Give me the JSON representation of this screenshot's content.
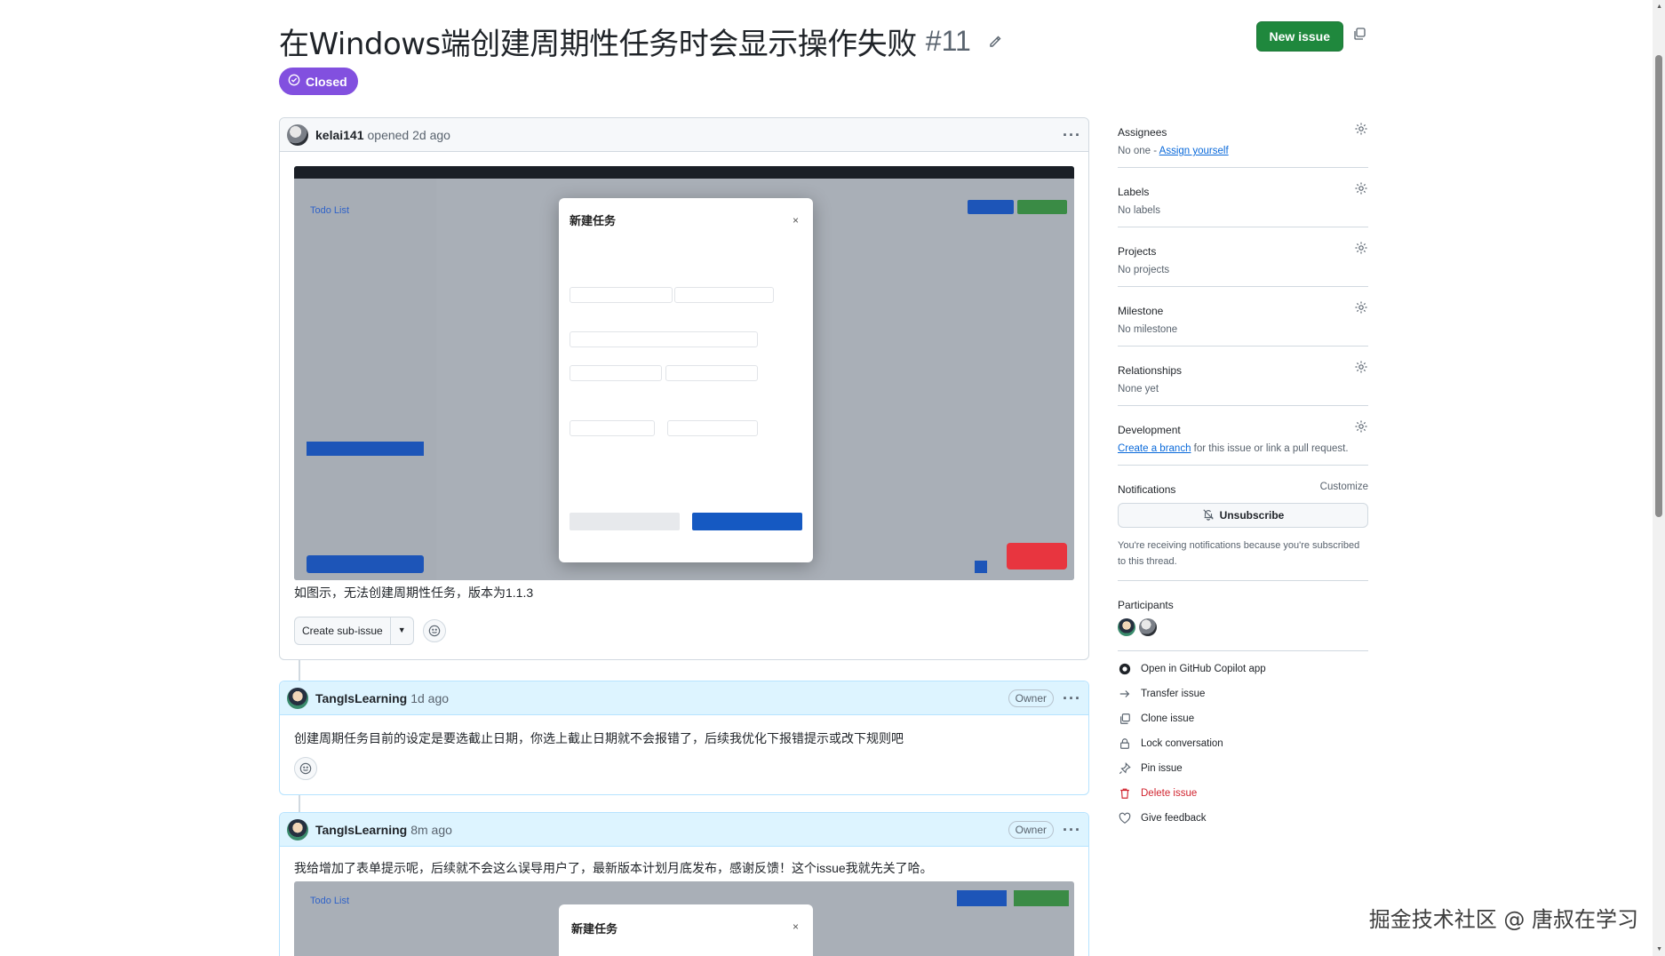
{
  "issue": {
    "title": "在Windows端创建周期性任务时会显示操作失败",
    "number": "#11",
    "state": "Closed",
    "new_issue_label": "New issue"
  },
  "comments": [
    {
      "author": "kelai141",
      "meta": "opened 2d ago",
      "body": "如图示，无法创建周期性任务，版本为1.1.3",
      "screenshot": {
        "app_title": "Todo List",
        "modal_title": "新建任务",
        "modal_close": "×"
      },
      "sub_issue_label": "Create sub-issue"
    },
    {
      "author": "TangIsLearning",
      "meta": "1d ago",
      "badge": "Owner",
      "body": "创建周期任务目前的设定是要选截止日期，你选上截止日期就不会报错了，后续我优化下报错提示或改下规则吧"
    },
    {
      "author": "TangIsLearning",
      "meta": "8m ago",
      "badge": "Owner",
      "body": "我给增加了表单提示呢，后续就不会这么误导用户了，最新版本计划月底发布，感谢反馈！这个issue我就先关了哈。",
      "screenshot": {
        "app_title": "Todo List",
        "modal_title": "新建任务",
        "modal_close": "×"
      }
    }
  ],
  "sidebar": {
    "assignees": {
      "label": "Assignees",
      "value": "No one - ",
      "link": "Assign yourself"
    },
    "labels": {
      "label": "Labels",
      "value": "No labels"
    },
    "projects": {
      "label": "Projects",
      "value": "No projects"
    },
    "milestone": {
      "label": "Milestone",
      "value": "No milestone"
    },
    "relationships": {
      "label": "Relationships",
      "value": "None yet"
    },
    "development": {
      "label": "Development",
      "link": "Create a branch",
      "value": " for this issue or link a pull request."
    },
    "notifications": {
      "label": "Notifications",
      "customize": "Customize",
      "button": "Unsubscribe",
      "note": "You're receiving notifications because you're subscribed to this thread."
    },
    "participants": {
      "label": "Participants"
    },
    "actions": [
      {
        "label": "Open in GitHub Copilot app",
        "icon": "copilot-icon"
      },
      {
        "label": "Transfer issue",
        "icon": "arrow-right-icon"
      },
      {
        "label": "Clone issue",
        "icon": "copy-icon"
      },
      {
        "label": "Lock conversation",
        "icon": "lock-icon"
      },
      {
        "label": "Pin issue",
        "icon": "pin-icon"
      },
      {
        "label": "Delete issue",
        "icon": "trash-icon"
      },
      {
        "label": "Give feedback",
        "icon": "heart-icon"
      }
    ]
  },
  "watermark": "掘金技术社区 @ 唐叔在学习",
  "colors": {
    "closed_badge": "#8250df",
    "new_issue_button": "#1f883d",
    "link": "#0969da",
    "danger": "#d1242f",
    "owner_header": "#ddf4ff"
  }
}
